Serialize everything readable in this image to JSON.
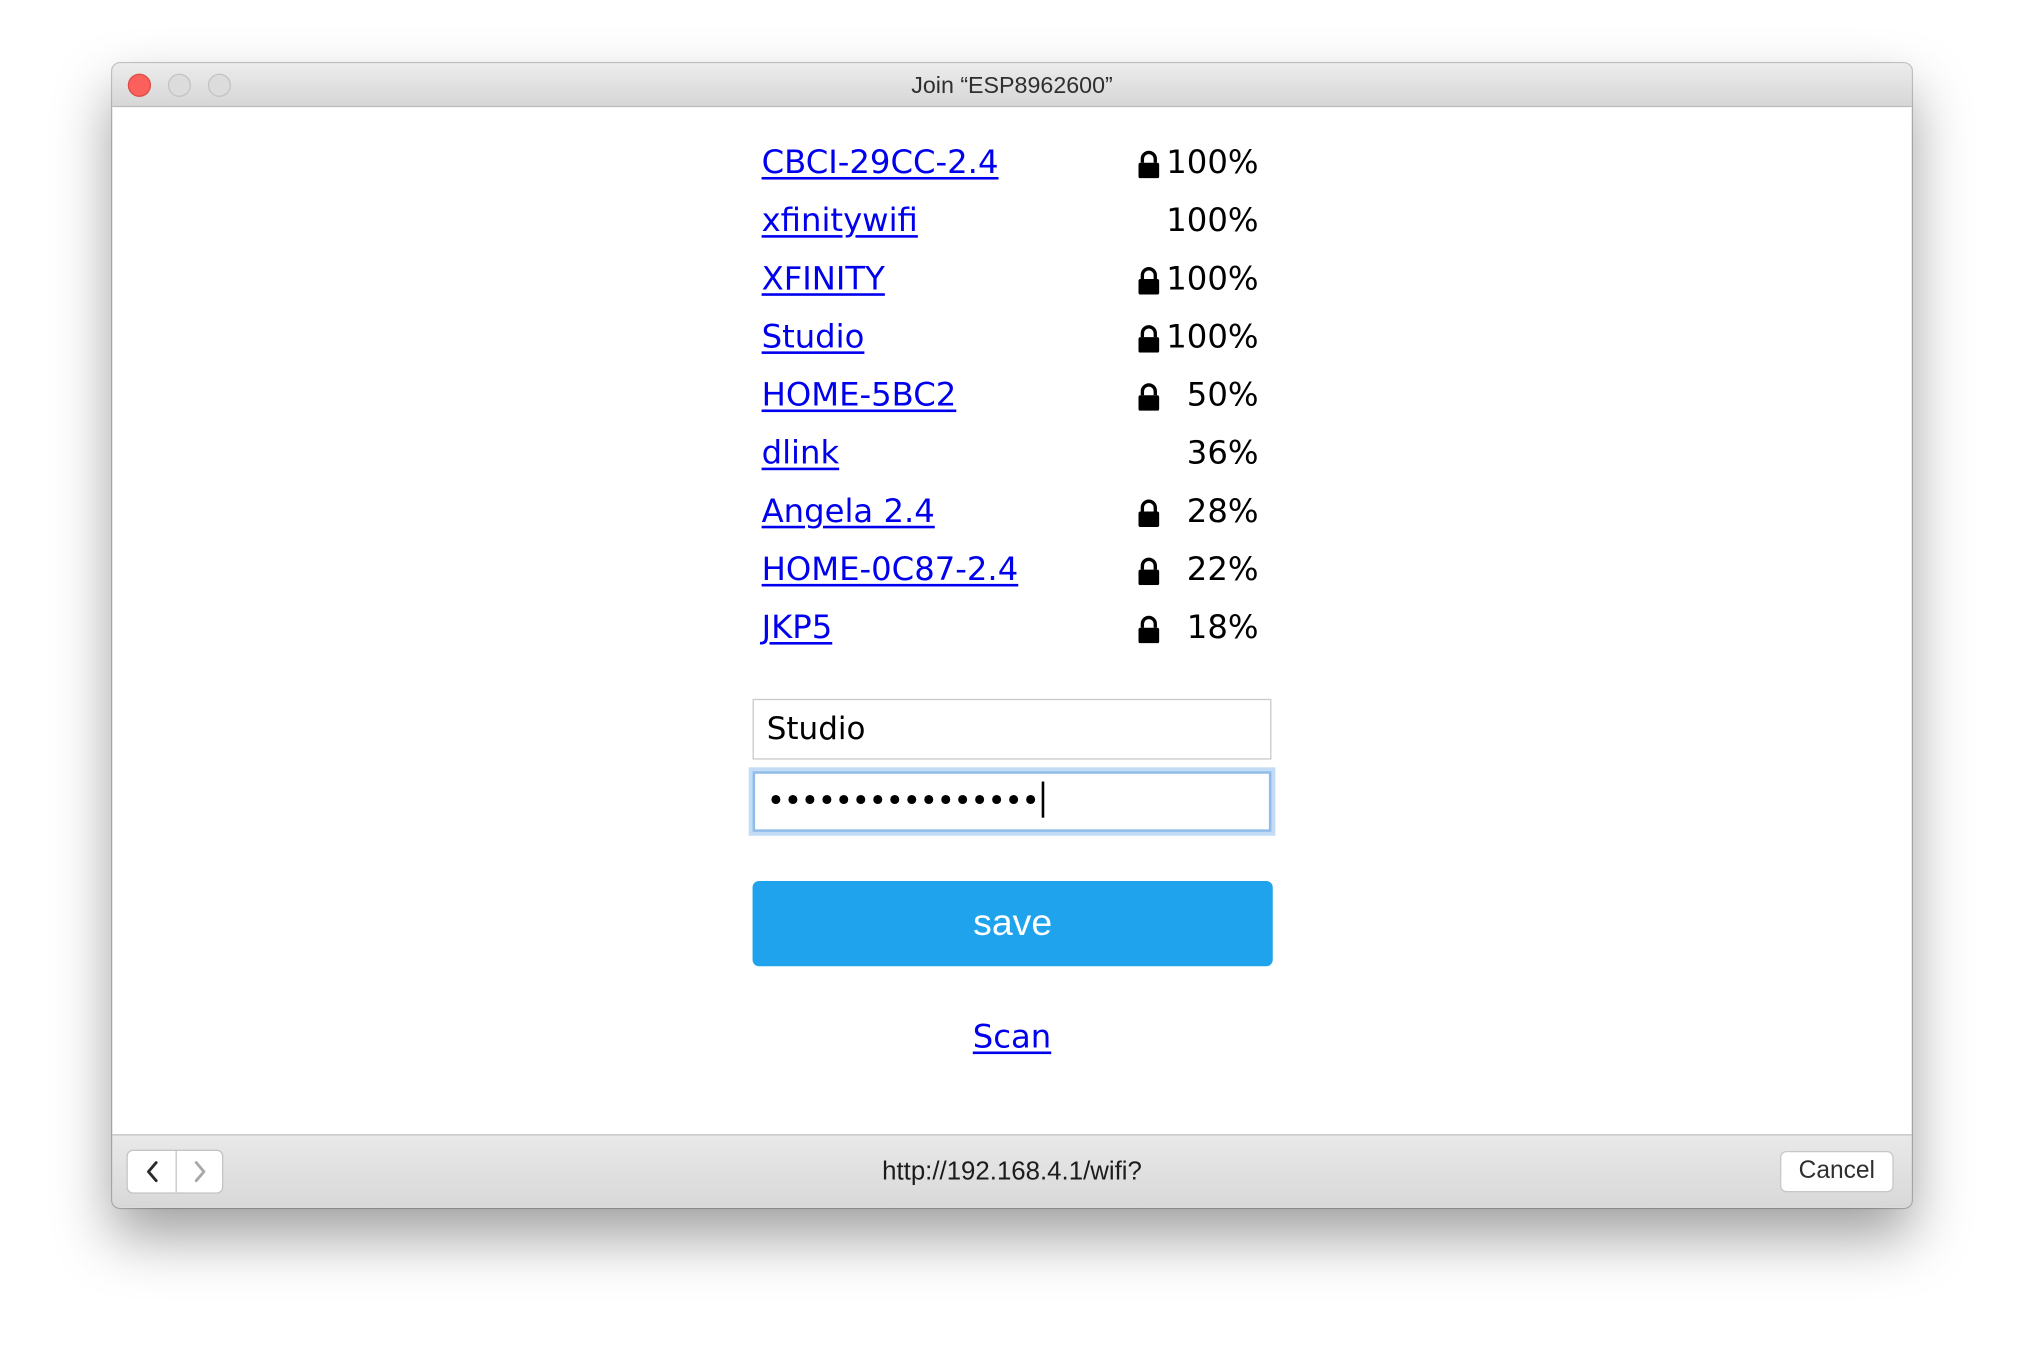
{
  "window": {
    "title": "Join “ESP8962600”"
  },
  "networks": [
    {
      "ssid": "CBCI-29CC-2.4",
      "secured": true,
      "signal": "100%"
    },
    {
      "ssid": "xfinitywifi",
      "secured": false,
      "signal": "100%"
    },
    {
      "ssid": "XFINITY",
      "secured": true,
      "signal": "100%"
    },
    {
      "ssid": "Studio",
      "secured": true,
      "signal": "100%"
    },
    {
      "ssid": "HOME-5BC2",
      "secured": true,
      "signal": "50%"
    },
    {
      "ssid": "dlink",
      "secured": false,
      "signal": "36%"
    },
    {
      "ssid": "Angela 2.4",
      "secured": true,
      "signal": "28%"
    },
    {
      "ssid": "HOME-0C87-2.4",
      "secured": true,
      "signal": "22%"
    },
    {
      "ssid": "JKP5",
      "secured": true,
      "signal": "18%"
    }
  ],
  "form": {
    "ssid_value": "Studio",
    "password_masked": "••••••••••••••••",
    "save_label": "save",
    "scan_label": "Scan"
  },
  "bottom_bar": {
    "url": "http://192.168.4.1/wifi?",
    "cancel_label": "Cancel"
  },
  "colors": {
    "link": "#0000ee",
    "save_button": "#1fa3ec",
    "close_traffic_light": "#fc605c",
    "focus_ring": "#8fbce9"
  },
  "icons": {
    "lock": "lock-icon",
    "back": "chevron-left-icon",
    "forward": "chevron-right-icon"
  }
}
